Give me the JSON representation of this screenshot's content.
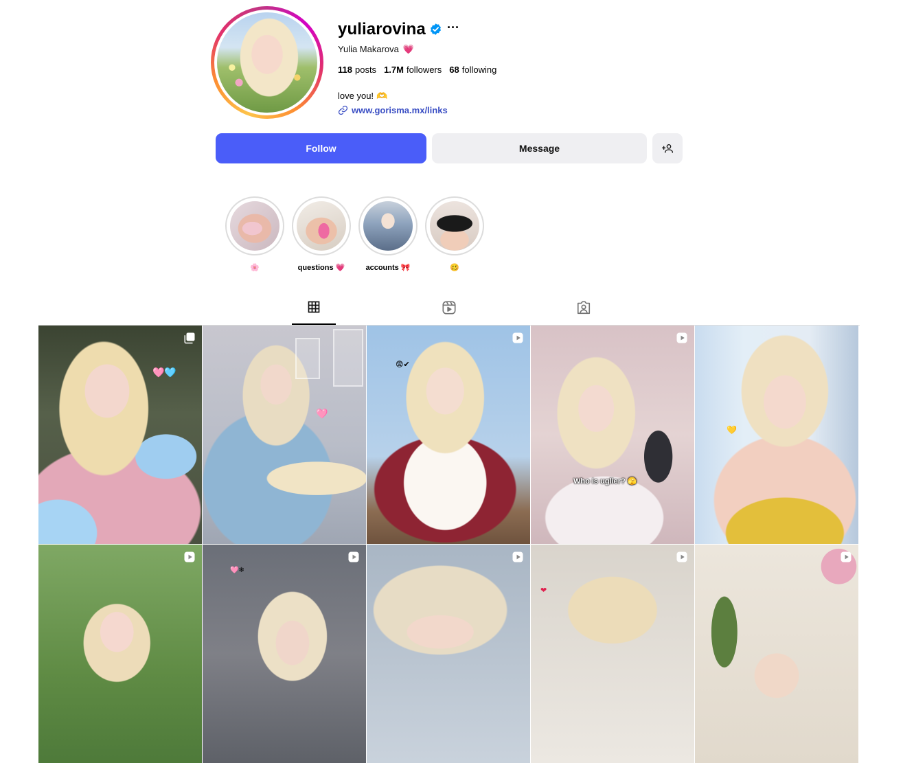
{
  "profile": {
    "username": "yuliarovina",
    "full_name": "Yulia Makarova",
    "full_name_emoji": "💗",
    "stats": {
      "posts_count": "118",
      "posts_label": "posts",
      "followers_count": "1.7M",
      "followers_label": "followers",
      "following_count": "68",
      "following_label": "following"
    },
    "bio": "love you!",
    "bio_emoji": "🫶",
    "link": "www.gorisma.mx/links",
    "verified": true
  },
  "buttons": {
    "follow": "Follow",
    "message": "Message",
    "add_user_icon": "person-plus-icon",
    "more_icon": "ellipsis-icon"
  },
  "highlights": [
    {
      "label": "🌸",
      "icon": "highlight-nails"
    },
    {
      "label": "questions 💗",
      "icon": "highlight-hand"
    },
    {
      "label": "accounts 🎀",
      "icon": "highlight-outfit"
    },
    {
      "label": "🥴",
      "icon": "highlight-skirt"
    }
  ],
  "tabs": [
    {
      "name": "posts",
      "icon": "grid-icon",
      "active": true
    },
    {
      "name": "reels",
      "icon": "reels-icon",
      "active": false
    },
    {
      "name": "tagged",
      "icon": "tagged-icon",
      "active": false
    }
  ],
  "posts": [
    {
      "type": "carousel",
      "sticker": "🩷🩵"
    },
    {
      "type": "image",
      "sticker": "🩷"
    },
    {
      "type": "reel",
      "sticker": "😨✔"
    },
    {
      "type": "reel",
      "overlay_text": "Who is uglier? 🫣"
    },
    {
      "type": "image",
      "sticker": "💛"
    },
    {
      "type": "reel"
    },
    {
      "type": "reel",
      "sticker": "🩷❄"
    },
    {
      "type": "reel"
    },
    {
      "type": "reel",
      "sticker": "❤"
    },
    {
      "type": "reel"
    }
  ],
  "colors": {
    "follow_button": "#4a5df9",
    "secondary_button": "#efeff2",
    "link": "#3b4fc4",
    "verified_badge": "#0095f6"
  }
}
